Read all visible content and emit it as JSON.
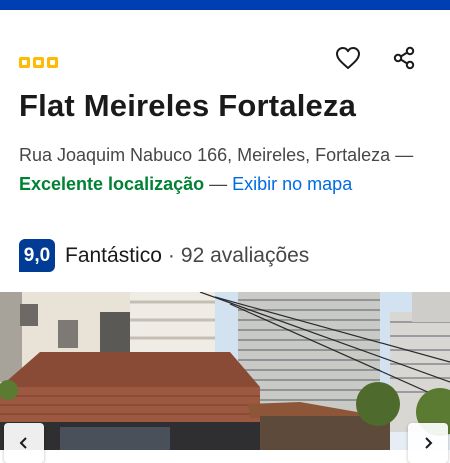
{
  "header": {
    "star_rating": 3,
    "brand_color": "#003eb3"
  },
  "hotel": {
    "name": "Flat Meireles Fortaleza",
    "address_line": "Rua Joaquim Nabuco 166, Meireles, Fortaleza",
    "separator": "—",
    "location_badge": "Excelente localização",
    "map_link": "Exibir no mapa"
  },
  "rating": {
    "score": "9,0",
    "word": "Fantástico",
    "dot": "·",
    "reviews": "92 avaliações"
  },
  "icons": {
    "favorite": "heart-icon",
    "share": "share-icon",
    "prev": "chevron-left-icon",
    "next": "chevron-right-icon"
  },
  "colors": {
    "score_bg": "#003b95",
    "good": "#008234",
    "link": "#006ce4",
    "star": "#febb02"
  }
}
